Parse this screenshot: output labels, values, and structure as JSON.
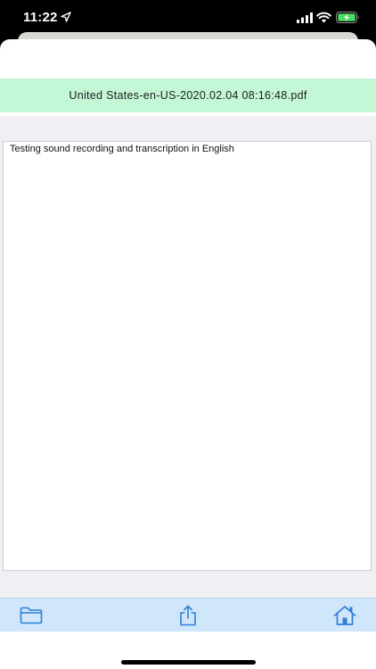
{
  "status_bar": {
    "time": "11:22"
  },
  "file_bar": {
    "file_name": "United States-en-US-2020.02.04 08:16:48.pdf"
  },
  "transcript": {
    "text": "Testing sound recording and transcription in English"
  },
  "toolbar": {
    "items": [
      {
        "icon": "folder-icon"
      },
      {
        "icon": "share-icon"
      },
      {
        "icon": "home-icon"
      }
    ]
  },
  "colors": {
    "file_bar_bg": "#c3f7d6",
    "toolbar_bg": "#cfe6fb",
    "icon_blue": "#2e7fd6",
    "content_bg": "#efeff4"
  }
}
